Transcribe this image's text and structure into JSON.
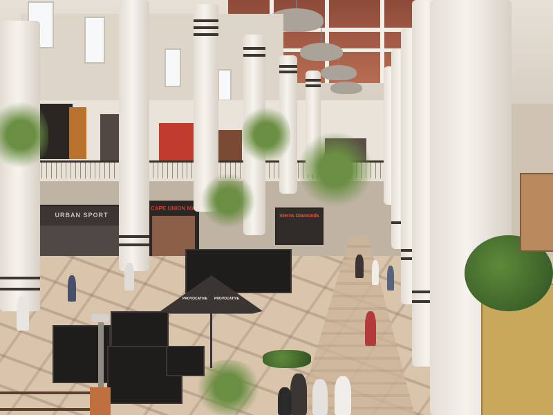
{
  "signs": {
    "cape_union_mart": "CAPE UNION MART",
    "left_store": "URBAN SPORT",
    "center_store": "Sterns Diamonds",
    "kiosk_umbrella": "PROVOCATIVE",
    "kiosk_umbrella_2": "PROVOCATIVE"
  }
}
